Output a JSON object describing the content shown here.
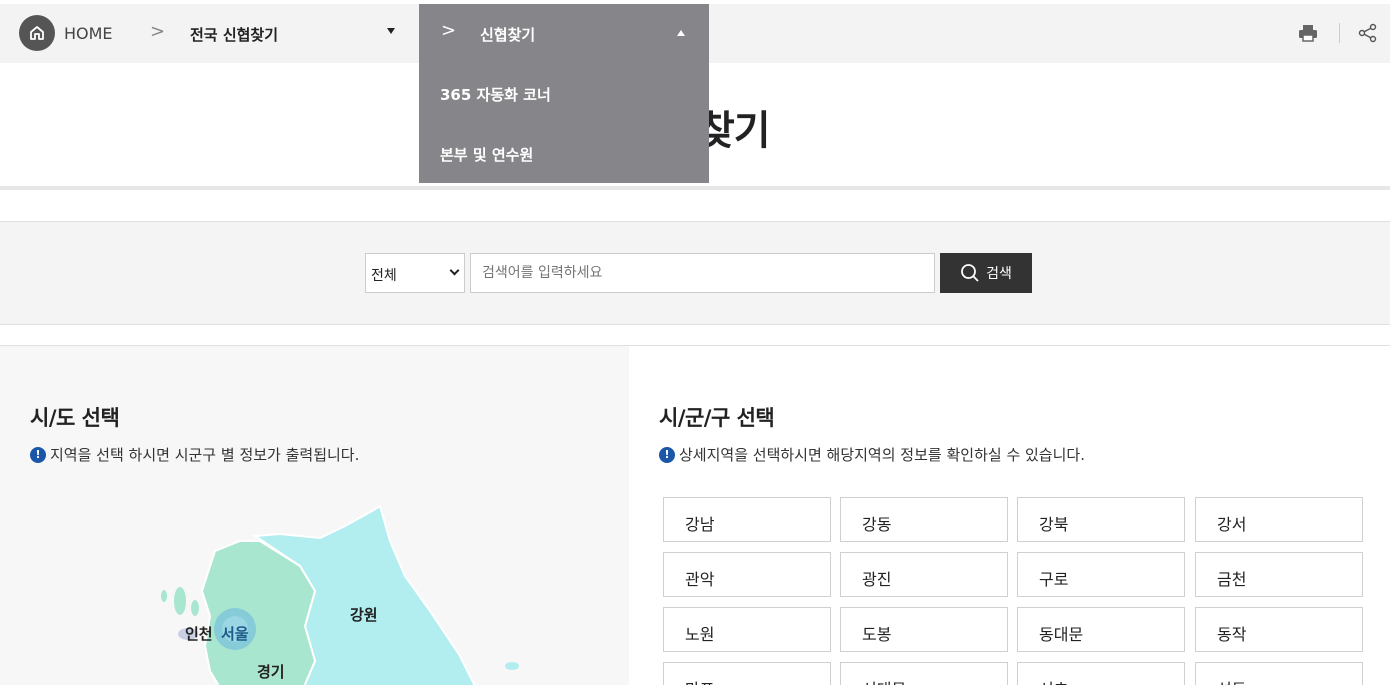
{
  "breadcrumb": {
    "home_label": "HOME",
    "depth1_label": "전국 신협찾기",
    "depth2_label": "신협찾기"
  },
  "dropdown": {
    "items": [
      "365 자동화 코너",
      "본부 및 연수원"
    ]
  },
  "page_title": "신협찾기",
  "search": {
    "scope_value": "전체",
    "placeholder": "검색어를 입력하세요",
    "button_label": "검색"
  },
  "left": {
    "title": "시/도 선택",
    "note": "지역을 선택 하시면 시군구 별 정보가 출력됩니다.",
    "map_labels": {
      "incheon": "인천",
      "seoul": "서울",
      "gangwon": "강원",
      "gyeonggi": "경기"
    }
  },
  "right": {
    "title": "시/군/구 선택",
    "note": "상세지역을 선택하시면 해당지역의 정보를 확인하실 수 있습니다.",
    "regions": [
      "강남",
      "강동",
      "강북",
      "강서",
      "관악",
      "광진",
      "구로",
      "금천",
      "노원",
      "도봉",
      "동대문",
      "동작",
      "마포",
      "서대문",
      "서초",
      "성동"
    ]
  },
  "colors": {
    "dropdown_bg": "#86868a",
    "search_button": "#333333",
    "info_icon": "#1b56a8",
    "map_gyeonggi": "#a9e6cf",
    "map_gangwon": "#b2eef0",
    "map_seoul": "#7fc7d9"
  }
}
